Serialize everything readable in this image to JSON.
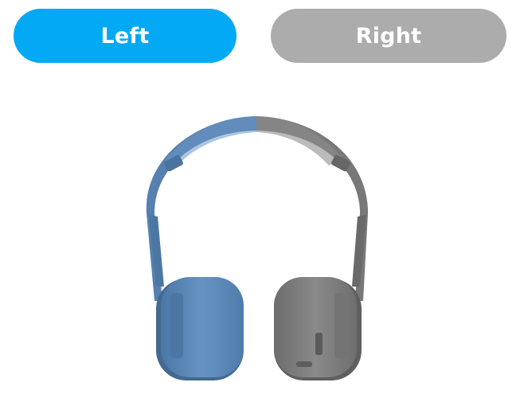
{
  "buttons": {
    "left_label": "Left",
    "right_label": "Right",
    "left_color": "#03a9f4",
    "right_color": "#acacac",
    "selected": "Left"
  },
  "product": {
    "icon": "headphones-icon",
    "left_color": "#5b87b5",
    "right_color": "#7d7d7d"
  }
}
